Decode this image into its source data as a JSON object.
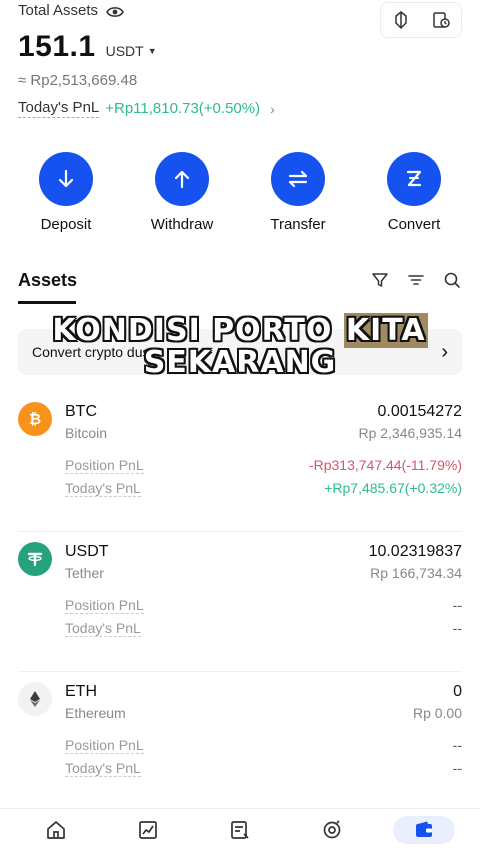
{
  "header": {
    "total_label": "Total Assets",
    "balance": "151.1",
    "unit": "USDT",
    "approx": "≈ Rp2,513,669.48",
    "pnl_label": "Today's PnL",
    "pnl_value": "+Rp11,810.73(+0.50%)"
  },
  "actions": [
    {
      "label": "Deposit",
      "icon": "arrow-down-icon"
    },
    {
      "label": "Withdraw",
      "icon": "arrow-up-icon"
    },
    {
      "label": "Transfer",
      "icon": "transfer-icon"
    },
    {
      "label": "Convert",
      "icon": "convert-icon"
    }
  ],
  "assets_tab": "Assets",
  "convert_bar": "Convert crypto dust",
  "overlay": {
    "line1_a": "KONDISI PORTO ",
    "line1_b": "KITA",
    "line2": "SEKARANG"
  },
  "assets": [
    {
      "symbol": "BTC",
      "name": "Bitcoin",
      "amount": "0.00154272",
      "fiat": "Rp 2,346,935.14",
      "position_label": "Position PnL",
      "position_value": "-Rp313,747.44(-11.79%)",
      "today_label": "Today's PnL",
      "today_value": "+Rp7,485.67(+0.32%)",
      "color": "#f7931a"
    },
    {
      "symbol": "USDT",
      "name": "Tether",
      "amount": "10.02319837",
      "fiat": "Rp 166,734.34",
      "position_label": "Position PnL",
      "position_value": "--",
      "today_label": "Today's PnL",
      "today_value": "--",
      "color": "#26a17b"
    },
    {
      "symbol": "ETH",
      "name": "Ethereum",
      "amount": "0",
      "fiat": "Rp 0.00",
      "position_label": "Position PnL",
      "position_value": "--",
      "today_label": "Today's PnL",
      "today_value": "--",
      "color": "#f2f2f2"
    }
  ],
  "colors": {
    "accent": "#1652f0",
    "positive": "#2ebd85",
    "negative": "#d6556b"
  }
}
